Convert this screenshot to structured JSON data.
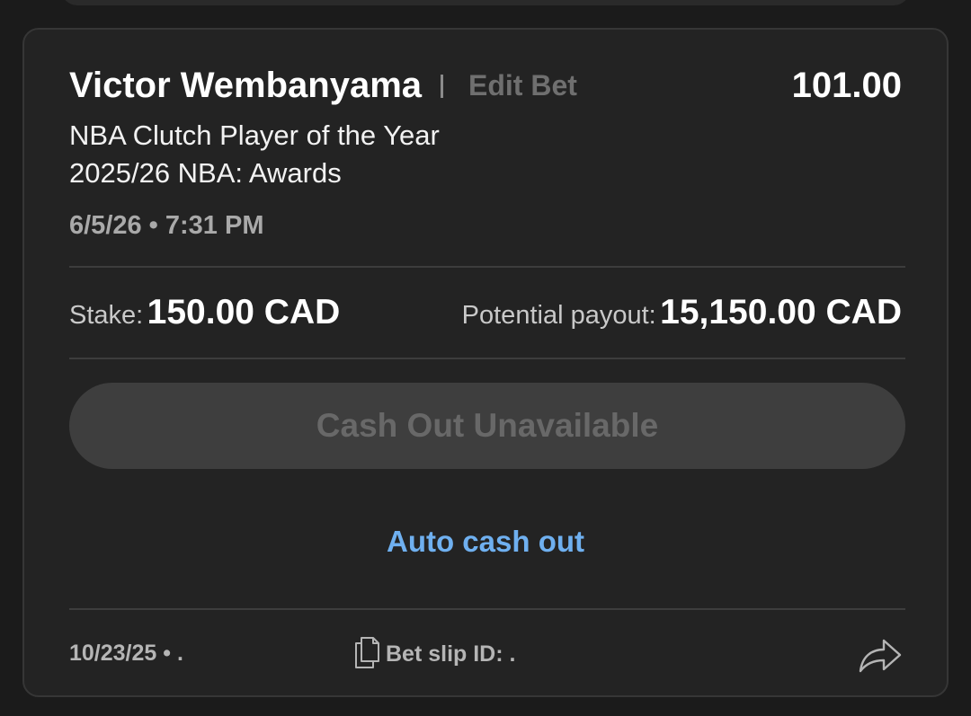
{
  "bet": {
    "selection": "Victor Wembanyama",
    "edit_label": "Edit Bet",
    "odds": "101.00",
    "market": "NBA Clutch Player of the Year",
    "event": "2025/26 NBA: Awards",
    "event_time": "6/5/26 • 7:31 PM",
    "stake_label": "Stake:",
    "stake_value": "150.00 CAD",
    "payout_label": "Potential payout:",
    "payout_value": "15,150.00 CAD",
    "cashout_label": "Cash Out Unavailable",
    "auto_cashout_label": "Auto cash out",
    "placed_date": "10/23/25 • .",
    "bet_slip_label": "Bet slip ID: ."
  },
  "icons": {
    "copy": "copy-icon",
    "share": "share-icon"
  },
  "colors": {
    "background": "#1b1b1b",
    "card": "#232323",
    "accent_link": "#6fb0f0",
    "disabled_button": "#3e3e3e",
    "disabled_text": "#686868"
  }
}
